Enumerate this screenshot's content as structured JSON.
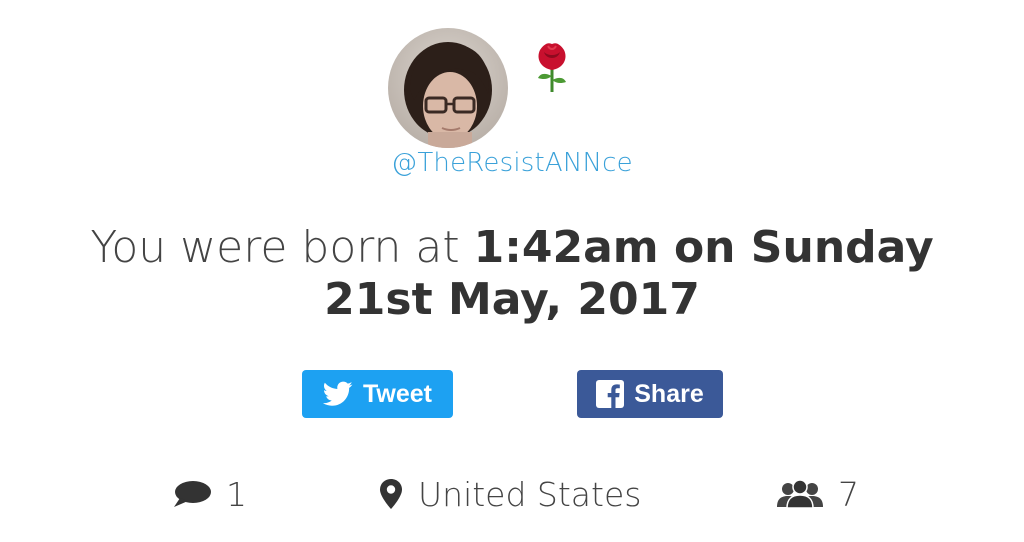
{
  "profile": {
    "handle": "@TheResistANNce"
  },
  "headline": {
    "prefix": "You were born at ",
    "time_day": "1:42am on Sunday",
    "date": "21st May, 2017"
  },
  "buttons": {
    "tweet_label": "Tweet",
    "share_label": "Share"
  },
  "stats": {
    "comments": "1",
    "location": "United States",
    "friends": "7"
  },
  "colors": {
    "twitter": "#1da1f2",
    "facebook": "#3b5998",
    "handle": "#3aa1d9"
  },
  "icons": {
    "avatar": "avatar-photo",
    "rose": "rose-icon",
    "twitter": "twitter-bird-icon",
    "facebook": "facebook-icon",
    "comment": "comment-bubble-icon",
    "location": "map-pin-icon",
    "friends": "group-icon"
  }
}
